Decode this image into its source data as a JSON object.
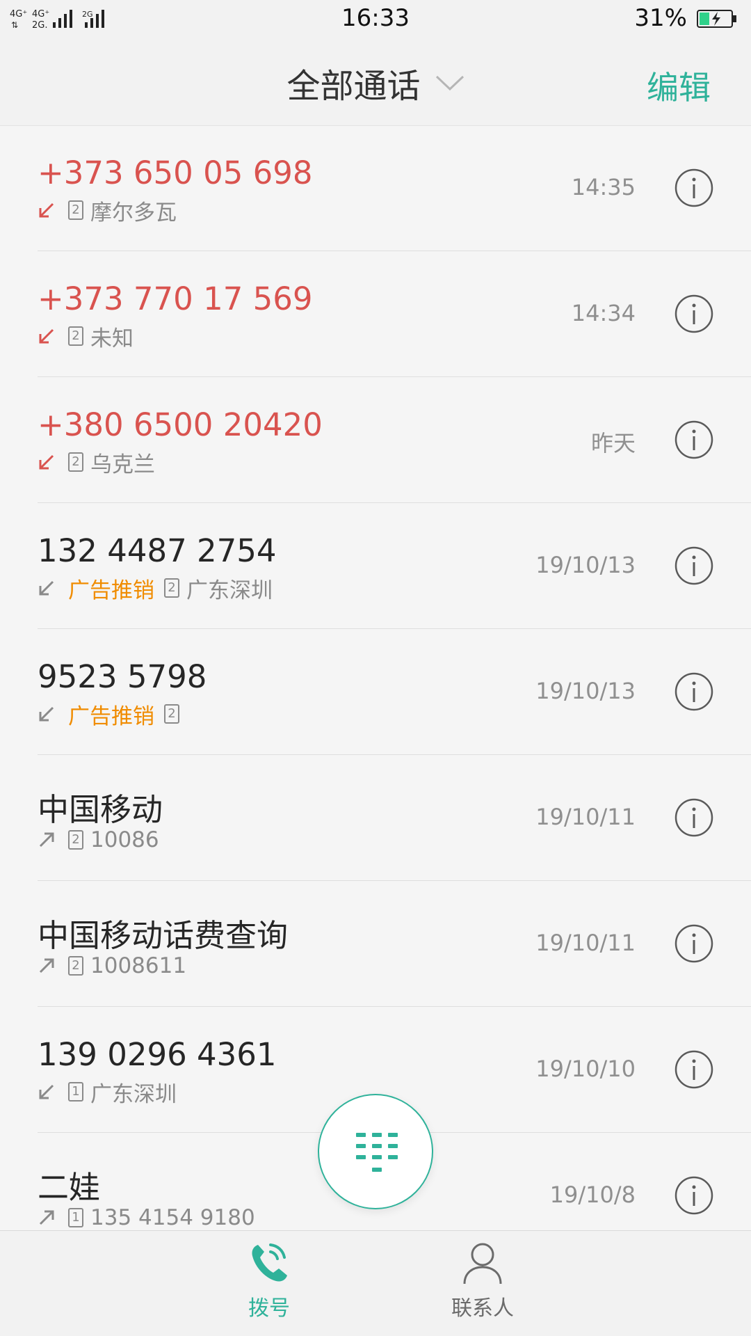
{
  "status_bar": {
    "network_left": "4G⁺ 4G⁺ 2G 2G",
    "time": "16:33",
    "battery_percent": "31%",
    "battery_level": 0.31
  },
  "header": {
    "title": "全部通话",
    "edit_label": "编辑"
  },
  "calls": [
    {
      "name": "+373 650 05 698",
      "direction": "missed",
      "tag": "",
      "sim": "2",
      "detail": "摩尔多瓦",
      "time": "14:35"
    },
    {
      "name": "+373 770 17 569",
      "direction": "missed",
      "tag": "",
      "sim": "2",
      "detail": "未知",
      "time": "14:34"
    },
    {
      "name": "+380 6500 20420",
      "direction": "missed",
      "tag": "",
      "sim": "2",
      "detail": "乌克兰",
      "time": "昨天"
    },
    {
      "name": "132 4487 2754",
      "direction": "incoming",
      "tag": "广告推销",
      "sim": "2",
      "detail": "广东深圳",
      "time": "19/10/13"
    },
    {
      "name": "9523 5798",
      "direction": "incoming",
      "tag": "广告推销",
      "sim": "2",
      "detail": "",
      "time": "19/10/13"
    },
    {
      "name": "中国移动",
      "direction": "outgoing",
      "tag": "",
      "sim": "2",
      "detail": "10086",
      "time": "19/10/11"
    },
    {
      "name": "中国移动话费查询",
      "direction": "outgoing",
      "tag": "",
      "sim": "2",
      "detail": "1008611",
      "time": "19/10/11"
    },
    {
      "name": "139 0296 4361",
      "direction": "incoming",
      "tag": "",
      "sim": "1",
      "detail": "广东深圳",
      "time": "19/10/10"
    },
    {
      "name": "二娃",
      "direction": "outgoing",
      "tag": "",
      "sim": "1",
      "detail": "135 4154 9180",
      "time": "19/10/8"
    }
  ],
  "bottom_nav": {
    "dial_label": "拨号",
    "contacts_label": "联系人"
  },
  "colors": {
    "accent": "#2fb29a",
    "missed": "#d9534f",
    "spam_tag": "#f08c00"
  },
  "icons": {
    "info": "info-circle-icon",
    "dialpad": "dialpad-icon",
    "phone": "phone-icon",
    "contacts": "person-icon"
  }
}
